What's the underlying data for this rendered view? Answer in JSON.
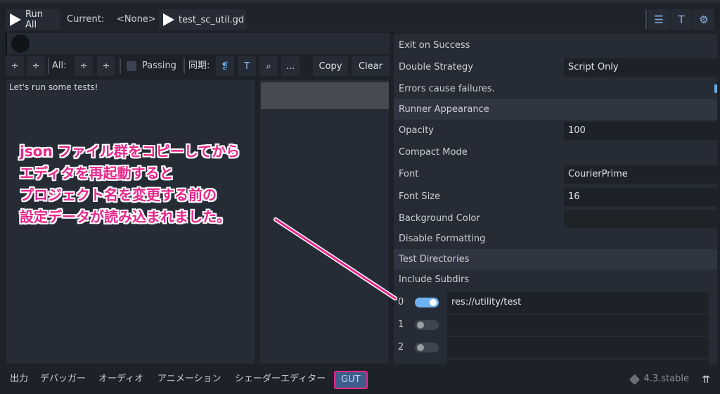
{
  "toolbar": {
    "run_all_label": "Run All",
    "current_label": "Current:",
    "current_value": "<None>",
    "script_label": "test_sc_util.gd",
    "icons": [
      "list-icon",
      "font-icon",
      "settings-icon"
    ]
  },
  "controls": {
    "all_label": "All:",
    "passing_label": "Passing",
    "sync_label": "同期:",
    "more_label": "...",
    "copy_label": "Copy",
    "clear_label": "Clear"
  },
  "output": {
    "text": "Let's run some tests!"
  },
  "settings": {
    "rows": [
      {
        "label": "Exit on Success"
      },
      {
        "label": "Double Strategy",
        "value": "Script Only"
      },
      {
        "label": "Errors cause failures."
      },
      {
        "label": "Runner Appearance",
        "section": true
      },
      {
        "label": "Opacity",
        "value": "100"
      },
      {
        "label": "Compact Mode"
      },
      {
        "label": "Font",
        "value": "CourierPrime"
      },
      {
        "label": "Font Size",
        "value": "16"
      },
      {
        "label": "Background Color",
        "value": ""
      },
      {
        "label": "Disable Formatting"
      },
      {
        "label": "Test Directories",
        "section": true
      },
      {
        "label": "Include Subdirs"
      }
    ],
    "directories": [
      {
        "index": "0",
        "enabled": true,
        "path": "res://utility/test"
      },
      {
        "index": "1",
        "enabled": false,
        "path": ""
      },
      {
        "index": "2",
        "enabled": false,
        "path": ""
      }
    ]
  },
  "annotation": {
    "lines": [
      "json ファイル群をコピーしてから",
      "エディタを再起動すると",
      "プロジェクト名を変更する前の",
      "設定データが読み込まれました。"
    ],
    "color": "#e8268b"
  },
  "bottombar": {
    "tabs": [
      "出力",
      "デバッガー",
      "オーディオ",
      "アニメーション",
      "シェーダーエディター",
      "GUT"
    ],
    "version": "4.3.stable"
  }
}
